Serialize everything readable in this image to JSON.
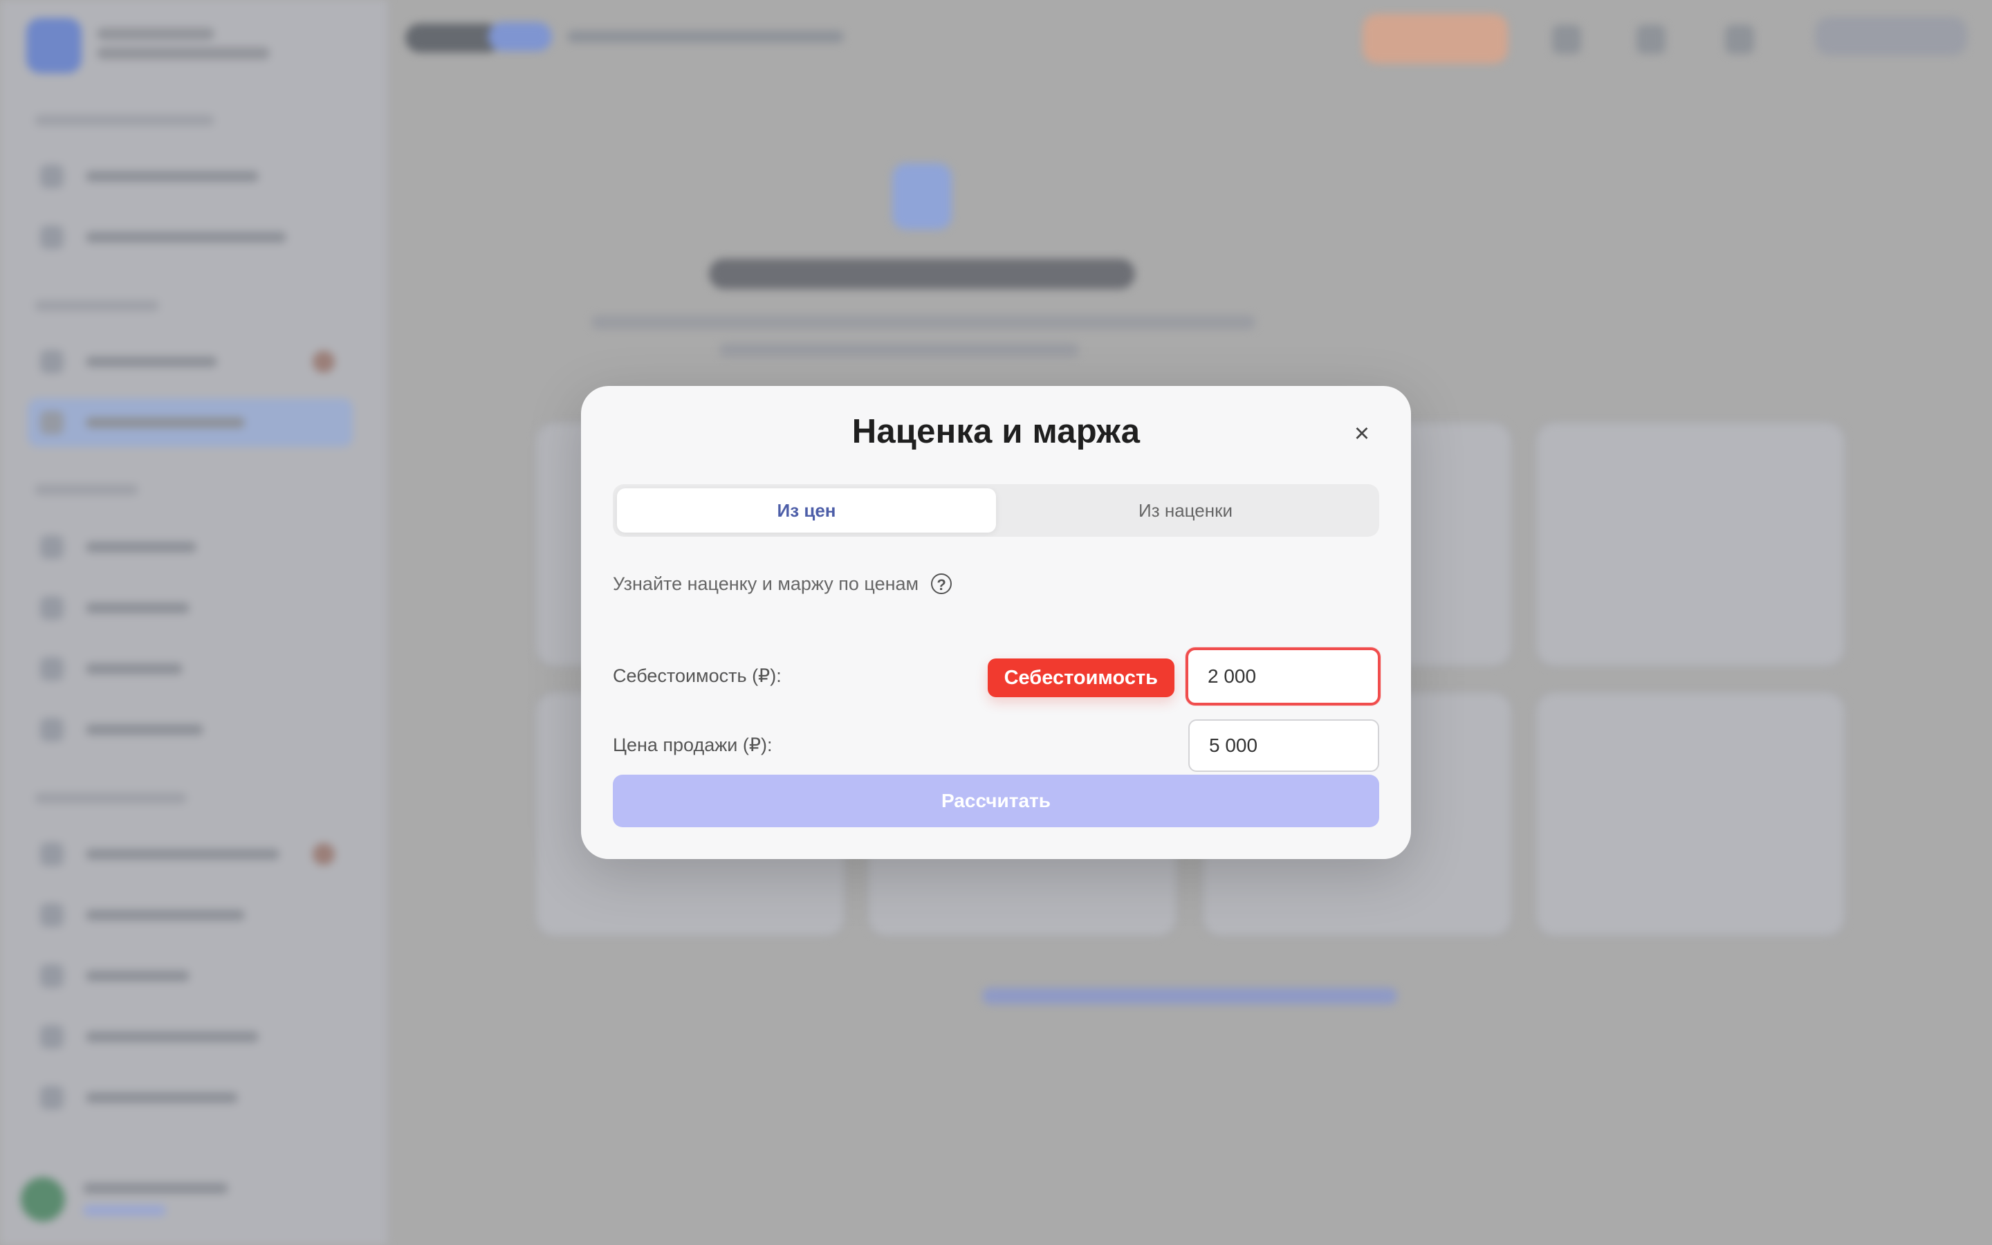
{
  "modal": {
    "title": "Наценка и маржа",
    "close_icon": "×",
    "tabs": [
      {
        "label": "Из цен"
      },
      {
        "label": "Из наценки"
      }
    ],
    "hint": {
      "text": "Узнайте наценку и маржу по ценам",
      "icon": "?"
    },
    "fields": [
      {
        "label": "Себестоимость (₽):",
        "value": "2 000",
        "annotation": "Себестоимость"
      },
      {
        "label": "Цена продажи (₽):",
        "value": "5 000"
      }
    ],
    "calculate_label": "Рассчитать"
  },
  "colors": {
    "accent": "#4D5EA8",
    "calculate_button": "#B9BDF7",
    "highlight": "#F04D4D",
    "annotation": "#F13A2F"
  },
  "icons": {
    "close": "close-icon",
    "help": "help-icon"
  }
}
